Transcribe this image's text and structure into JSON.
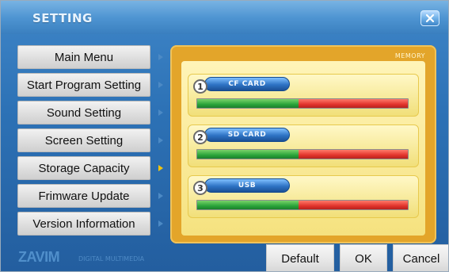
{
  "window": {
    "title": "SETTING"
  },
  "sidebar": {
    "items": [
      {
        "label": "Main Menu"
      },
      {
        "label": "Start Program Setting"
      },
      {
        "label": "Sound Setting"
      },
      {
        "label": "Screen Setting"
      },
      {
        "label": "Storage Capacity",
        "active": true
      },
      {
        "label": "Frimware Update"
      },
      {
        "label": "Version Information"
      }
    ]
  },
  "storage_panel": {
    "header_label": "MEMORY",
    "cards": [
      {
        "number": "1",
        "name": "CF CARD",
        "used_fraction": 0.48
      },
      {
        "number": "2",
        "name": "SD CARD",
        "used_fraction": 0.48
      },
      {
        "number": "3",
        "name": "USB",
        "used_fraction": 0.48
      }
    ]
  },
  "footer": {
    "brand": "ZAVIM",
    "tagline": "DIGITAL MULTIMEDIA",
    "buttons": {
      "default": "Default",
      "ok": "OK",
      "cancel": "Cancel"
    }
  },
  "icons": {
    "close": "close-icon",
    "arrow": "triangle-right-icon"
  },
  "colors": {
    "window_blue": "#2d72b6",
    "panel_orange": "#e3a52a",
    "panel_yellow": "#f5e27f",
    "bar_green": "#2aa43a",
    "bar_red": "#e2342c",
    "active_arrow": "#f1c40f"
  }
}
